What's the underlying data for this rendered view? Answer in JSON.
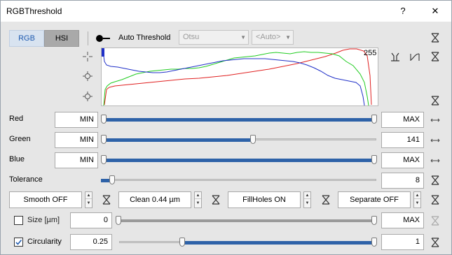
{
  "window": {
    "title": "RGBThreshold",
    "help": "?",
    "close": "✕"
  },
  "toolbar": {
    "tab_rgb": "RGB",
    "tab_hsi": "HSI",
    "auto_threshold_label": "Auto Threshold",
    "method_value": "Otsu",
    "auto_value": "<Auto>"
  },
  "histogram": {
    "max_label": "255"
  },
  "channels": [
    {
      "label": "Red",
      "min": "MIN",
      "max": "MAX",
      "low_fraction": 0.0,
      "high_fraction": 1.0
    },
    {
      "label": "Green",
      "min": "MIN",
      "max": "141",
      "low_fraction": 0.0,
      "high_fraction": 0.553
    },
    {
      "label": "Blue",
      "min": "MIN",
      "max": "MAX",
      "low_fraction": 0.0,
      "high_fraction": 1.0
    }
  ],
  "tolerance": {
    "label": "Tolerance",
    "value": "8",
    "fraction": 0.03
  },
  "ops": {
    "smooth": "Smooth OFF",
    "clean": "Clean 0.44 µm",
    "fillholes": "FillHoles ON",
    "separate": "Separate OFF"
  },
  "size": {
    "label": "Size [µm]",
    "checked": false,
    "min": "0",
    "max": "MAX"
  },
  "circularity": {
    "label": "Circularity",
    "checked": true,
    "min": "0.25",
    "max": "1",
    "low_fraction": 0.25,
    "high_fraction": 1.0
  },
  "colors": {
    "red": "#e02020",
    "green": "#22cc22",
    "blue": "#2030c8",
    "accent": "#2e62a8"
  }
}
